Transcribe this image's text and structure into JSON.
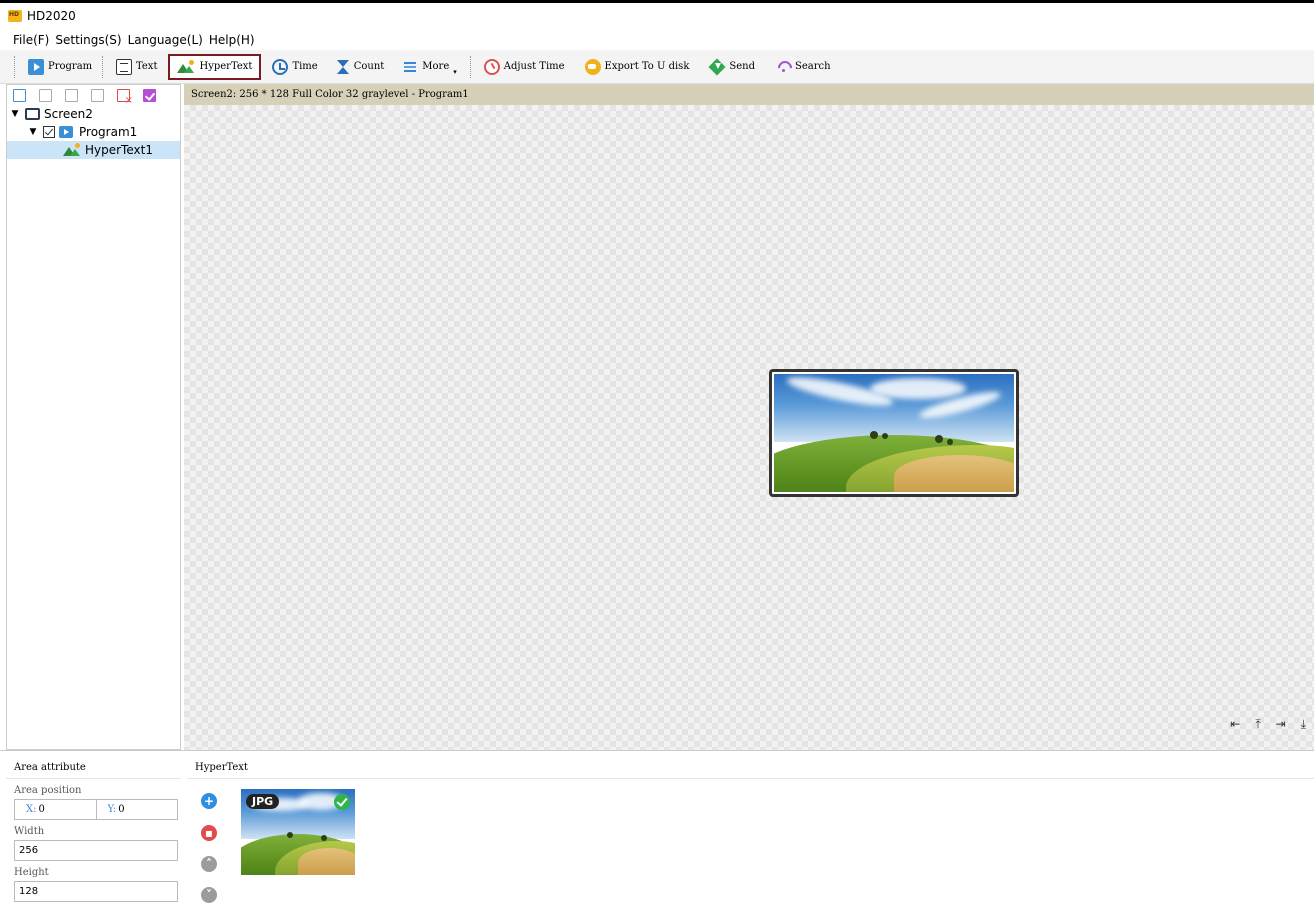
{
  "app": {
    "title": "HD2020"
  },
  "menu": [
    "File(F)",
    "Settings(S)",
    "Language(L)",
    "Help(H)"
  ],
  "toolbar": {
    "program": "Program",
    "text": "Text",
    "hypertext": "HyperText",
    "time": "Time",
    "count": "Count",
    "more": "More",
    "adjust_time": "Adjust Time",
    "export": "Export To U disk",
    "send": "Send",
    "search": "Search",
    "active": "HyperText"
  },
  "tree": {
    "screen": "Screen2",
    "program": "Program1",
    "item": "HyperText1",
    "selected": "HyperText1"
  },
  "screen_info": "Screen2: 256 * 128 Full Color 32 graylevel - Program1",
  "area_attribute": {
    "title": "Area attribute",
    "position_label": "Area position",
    "x_label": "X:",
    "x_value": "0",
    "y_label": "Y:",
    "y_value": "0",
    "width_label": "Width",
    "width_value": "256",
    "height_label": "Height",
    "height_value": "128"
  },
  "hypertext_panel": {
    "title": "HyperText",
    "file_type": "JPG"
  },
  "colors": {
    "active_border": "#7b1a21",
    "info_bar": "#d6d0b8",
    "selected_row": "#cce4f7",
    "add": "#2f8ee0",
    "delete": "#e44a4a"
  }
}
